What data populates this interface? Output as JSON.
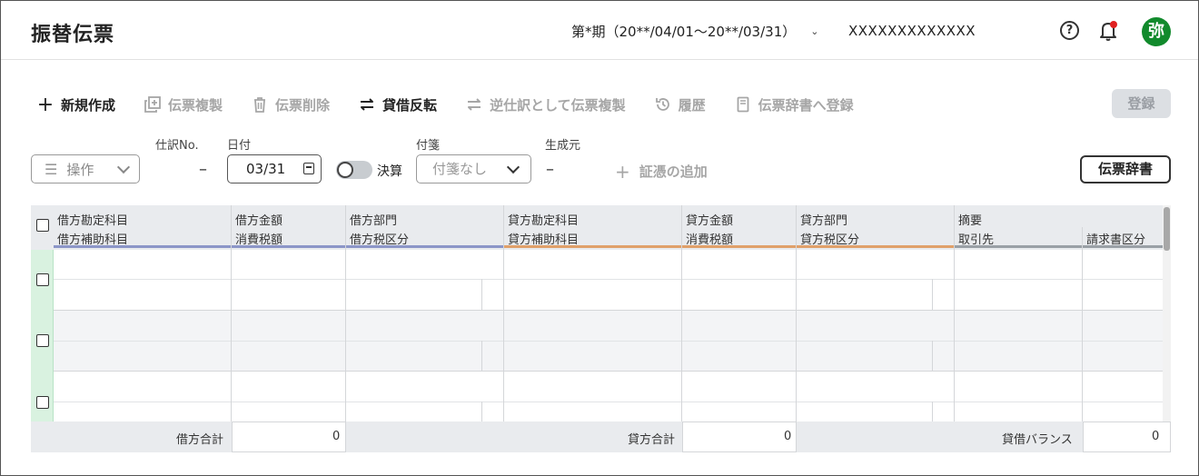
{
  "header": {
    "title": "振替伝票",
    "period": "第*期（20**/04/01〜20**/03/31）",
    "company": "XXXXXXXXXXXXX",
    "help_glyph": "?",
    "avatar_initial": "弥"
  },
  "toolbar": {
    "new": "新規作成",
    "copy": "伝票複製",
    "delete": "伝票削除",
    "reverse": "貸借反転",
    "reverse_copy": "逆仕訳として伝票複製",
    "history": "履歴",
    "register_dict": "伝票辞書へ登録",
    "register": "登録"
  },
  "filters": {
    "operations_label": "操作",
    "entry_no_label": "仕訳No.",
    "entry_no_value": "–",
    "date_label": "日付",
    "date_value": "03/31",
    "closing_label": "決算",
    "tag_label": "付箋",
    "tag_value": "付箋なし",
    "source_label": "生成元",
    "source_value": "–",
    "add_evidence": "証憑の追加",
    "dictionary": "伝票辞書"
  },
  "table": {
    "headers_top": [
      "借方勘定科目",
      "借方金額",
      "借方部門",
      "貸方勘定科目",
      "貸方金額",
      "貸方部門",
      "摘要"
    ],
    "headers_bottom": [
      "借方補助科目",
      "消費税額",
      "借方税区分",
      "貸方補助科目",
      "消費税額",
      "貸方税区分",
      "取引先",
      "請求書区分"
    ],
    "colors": {
      "debit": "#8c96c8",
      "credit": "#e0a06a",
      "summary": "#9aa0a6"
    },
    "footer": {
      "debit_total_label": "借方合計",
      "debit_total_value": "0",
      "credit_total_label": "貸方合計",
      "credit_total_value": "0",
      "balance_label": "貸借バランス",
      "balance_value": "0"
    }
  }
}
